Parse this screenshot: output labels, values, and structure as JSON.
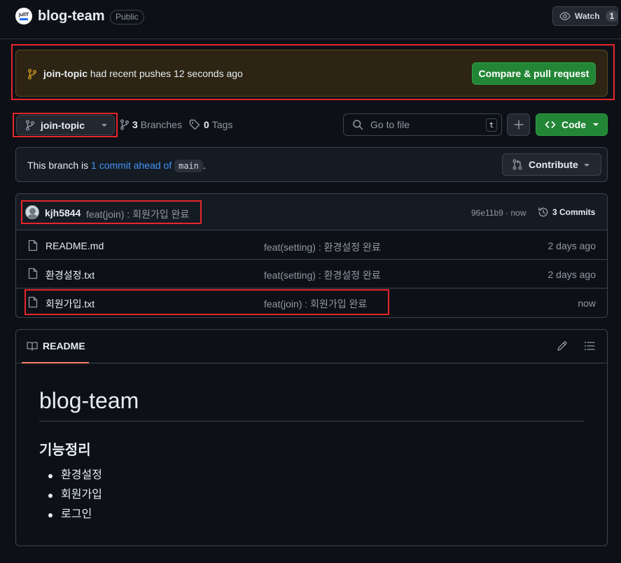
{
  "header": {
    "repo_name": "blog-team",
    "visibility": "Public",
    "watch_label": "Watch",
    "watch_count": "1",
    "logo_text": "jullT"
  },
  "push_banner": {
    "branch": "join-topic",
    "message": "had recent pushes 12 seconds ago",
    "button": "Compare & pull request"
  },
  "toolbar": {
    "current_branch": "join-topic",
    "branches_count": "3",
    "branches_label": "Branches",
    "tags_count": "0",
    "tags_label": "Tags",
    "search_placeholder": "Go to file",
    "search_shortcut": "t",
    "code_button": "Code"
  },
  "ahead": {
    "prefix": "This branch is",
    "link": "1 commit ahead of",
    "base": "main",
    "suffix": ".",
    "contribute": "Contribute"
  },
  "latest_commit": {
    "author": "kjh5844",
    "message": "feat(join) : 회원가입 완료",
    "meta": "96e11b9 · now",
    "commits_label": "3 Commits"
  },
  "files": [
    {
      "name": "README.md",
      "message": "feat(setting) : 환경설정 완료",
      "date": "2 days ago"
    },
    {
      "name": "환경설정.txt",
      "message": "feat(setting) : 환경설정 완료",
      "date": "2 days ago"
    },
    {
      "name": "회원가입.txt",
      "message": "feat(join) : 회원가입 완료",
      "date": "now"
    }
  ],
  "readme": {
    "tab_label": "README",
    "title": "blog-team",
    "section_heading": "기능정리",
    "items": [
      "환경설정",
      "회원가입",
      "로그인"
    ]
  },
  "colors": {
    "background": "#0d1117",
    "accent_green": "#238636",
    "link_blue": "#4493f8",
    "highlight_red": "#e5262b",
    "banner_bg": "#2d2413",
    "tab_underline": "#f78166"
  },
  "icons": {
    "watch": "eye-icon",
    "branch": "git-branch-icon",
    "tag": "tag-icon",
    "search": "search-icon",
    "add": "plus-icon",
    "code": "code-icon",
    "contribute": "git-pull-request-icon",
    "history": "history-icon",
    "file": "file-icon",
    "readme": "book-icon",
    "edit": "pencil-icon",
    "toc": "list-unordered-icon"
  }
}
